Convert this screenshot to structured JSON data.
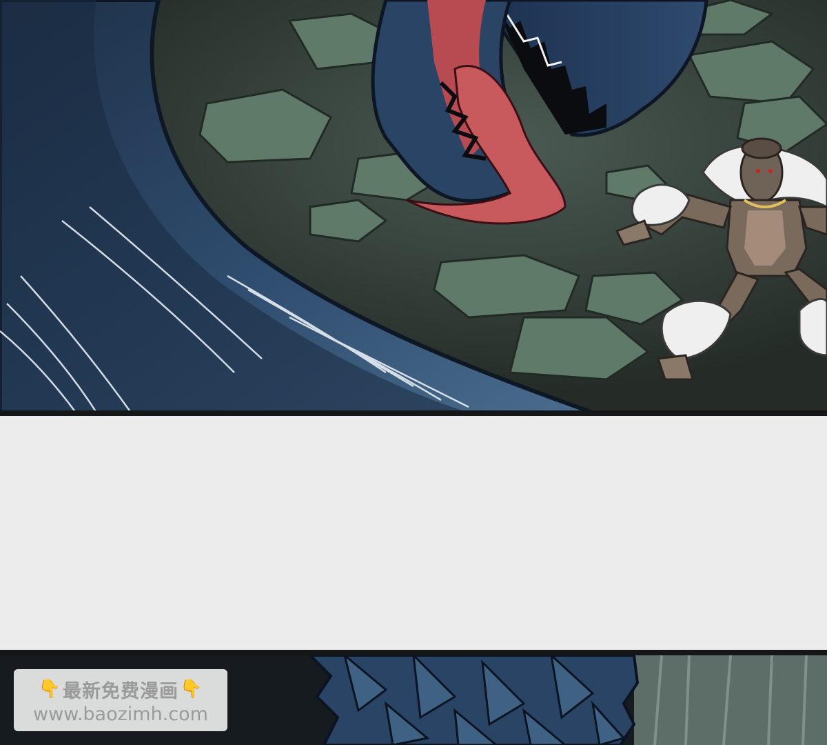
{
  "comic": {
    "panels": [
      {
        "name": "serpent-lunge-panel"
      },
      {
        "name": "scaled-body-panel"
      }
    ]
  },
  "watermark": {
    "left_icon": "pointing-down-hand-icon",
    "headline": "最新免费漫画",
    "right_icon": "pointing-down-hand-icon",
    "url": "www.baozimh.com"
  },
  "colors": {
    "gutter": "#ececec",
    "panel_border": "#141618",
    "serpent_blue": "#2d4a6a",
    "tongue_red": "#c85a5e",
    "ground_green": "#5f7a68",
    "ape_brown": "#7a6a5c"
  }
}
